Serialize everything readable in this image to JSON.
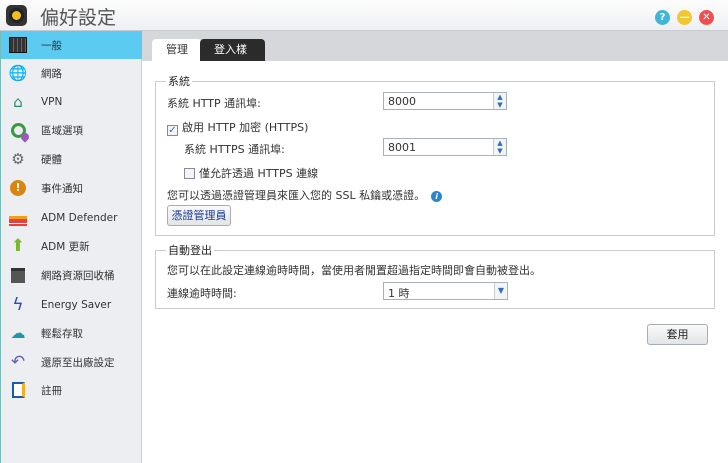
{
  "window": {
    "title": "偏好設定",
    "help_icon": "question-icon",
    "minimize_icon": "minus-icon",
    "close_icon": "close-icon"
  },
  "sidebar": {
    "items": [
      {
        "label": "一般",
        "icon": "server-icon",
        "selected": true
      },
      {
        "label": "網路",
        "icon": "globe-icon"
      },
      {
        "label": "VPN",
        "icon": "house-network-icon"
      },
      {
        "label": "區域選項",
        "icon": "globe-pin-icon"
      },
      {
        "label": "硬體",
        "icon": "wrench-icon"
      },
      {
        "label": "事件通知",
        "icon": "alert-icon"
      },
      {
        "label": "ADM Defender",
        "icon": "firewall-icon"
      },
      {
        "label": "ADM 更新",
        "icon": "arrow-up-icon"
      },
      {
        "label": "網路資源回收桶",
        "icon": "trash-icon"
      },
      {
        "label": "Energy Saver",
        "icon": "lightning-icon"
      },
      {
        "label": "輕鬆存取",
        "icon": "cloud-upload-icon"
      },
      {
        "label": "還原至出廠設定",
        "icon": "undo-icon"
      },
      {
        "label": "註冊",
        "icon": "register-icon"
      }
    ]
  },
  "tabs": [
    {
      "label": "管理",
      "active": true
    },
    {
      "label": "登入樣式",
      "active": false
    }
  ],
  "system": {
    "legend": "系統",
    "http_port_label": "系統 HTTP 通訊埠:",
    "http_port": "8000",
    "https_enable_label": "啟用 HTTP 加密 (HTTPS)",
    "https_enabled": true,
    "https_port_label": "系統 HTTPS 通訊埠:",
    "https_port": "8001",
    "https_only_label": "僅允許透過 HTTPS 連線",
    "https_only": false,
    "cert_note": "您可以透過憑證管理員來匯入您的 SSL 私鑰或憑證。",
    "cert_button": "憑證管理員"
  },
  "autologout": {
    "legend": "自動登出",
    "note": "您可以在此設定連線逾時時間，當使用者閒置超過指定時間即會自動被登出。",
    "timeout_label": "連線逾時時間:",
    "timeout_value": "1 時"
  },
  "apply_button": "套用",
  "colors": {
    "selected": "#5ccbf1",
    "sidebar_bg": "#eceef2",
    "tab_dark": "#2b2b2b"
  }
}
